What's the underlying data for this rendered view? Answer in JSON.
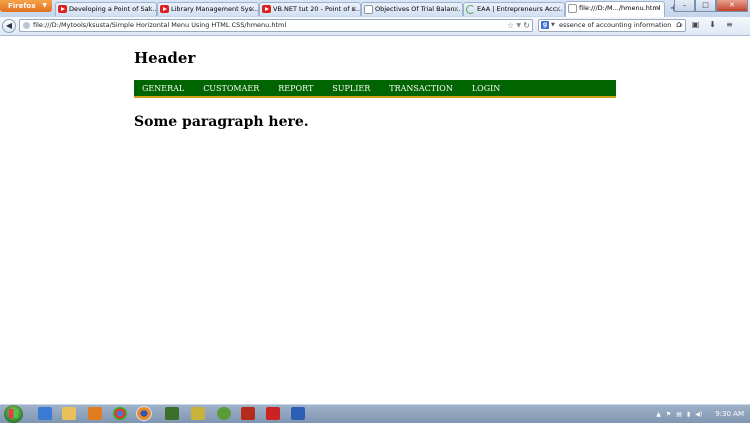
{
  "browser": {
    "app_button": "Firefox",
    "tabs": [
      {
        "title": "Developing a Point of Sal...",
        "icon": "youtube-icon",
        "active": false
      },
      {
        "title": "Library Management Sys...",
        "icon": "youtube-icon",
        "active": false
      },
      {
        "title": "VB.NET tut 20 - Point of s...",
        "icon": "youtube-icon",
        "active": false
      },
      {
        "title": "Objectives Of Trial Balan...",
        "icon": "document-icon",
        "active": false
      },
      {
        "title": "EAA | Entrepreneurs Acc...",
        "icon": "loading-icon",
        "active": false
      },
      {
        "title": "file:///D:/M.../hmenu.html",
        "icon": "document-icon",
        "active": true
      }
    ],
    "url": "file:///D:/Mytools/ksusta/Simple Horizontal Menu Using HTML CSS/hmenu.html",
    "search_query": "essence of accounting information"
  },
  "page": {
    "header": "Header",
    "menu": [
      "GENERAL",
      "CUSTOMAER",
      "REPORT",
      "SUPLIER",
      "TRANSACTION",
      "LOGIN"
    ],
    "paragraph": "Some paragraph here."
  },
  "taskbar": {
    "clock": "9:30 AM"
  },
  "colors": {
    "menu_background": "#006400",
    "menu_border": "#d4a017",
    "menu_text": "#ffffff"
  }
}
